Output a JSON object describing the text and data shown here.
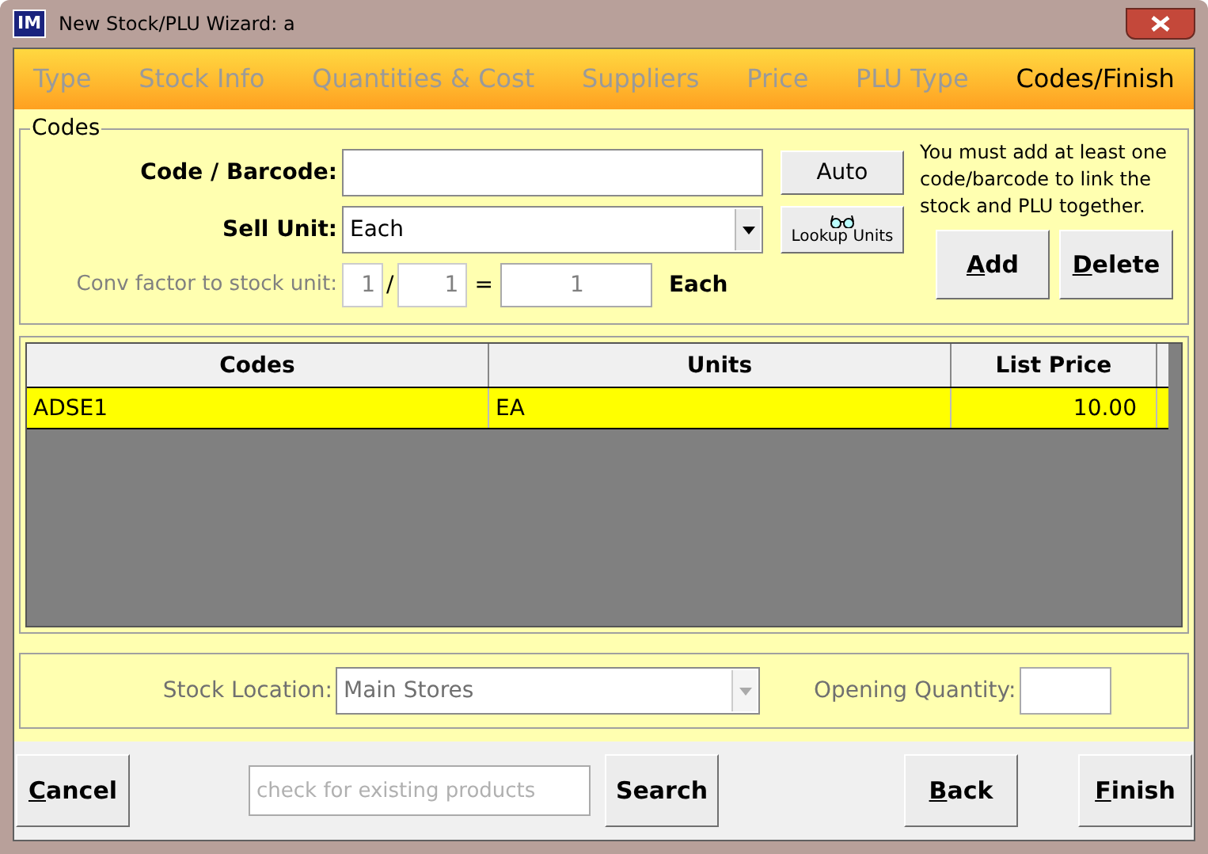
{
  "window": {
    "title": "New Stock/PLU Wizard: a",
    "logo": "IM"
  },
  "tabs": [
    {
      "label": "Type",
      "selected": false
    },
    {
      "label": "Stock Info",
      "selected": false
    },
    {
      "label": "Quantities & Cost",
      "selected": false
    },
    {
      "label": "Suppliers",
      "selected": false
    },
    {
      "label": "Price",
      "selected": false
    },
    {
      "label": "PLU Type",
      "selected": false
    },
    {
      "label": "Codes/Finish",
      "selected": true
    }
  ],
  "codes": {
    "title": "Codes",
    "code_label": "Code / Barcode:",
    "auto_button": "Auto",
    "sell_unit_label": "Sell Unit:",
    "sell_unit_value": "Each",
    "lookup_button": "Lookup Units",
    "conv_label": "Conv factor to stock unit:",
    "conv_num": "1",
    "conv_slash": "/",
    "conv_den": "1",
    "conv_equals": "=",
    "conv_result": "1",
    "conv_unit": "Each",
    "hint": "You must add at least one code/barcode to link the stock and PLU together.",
    "add_button": {
      "label": "Add",
      "underline_first": true
    },
    "delete_button": {
      "label": "Delete",
      "underline_first": true
    }
  },
  "table": {
    "columns": [
      "Codes",
      "Units",
      "List Price"
    ],
    "rows": [
      {
        "cells": [
          "ADSE1",
          "EA",
          "10.00"
        ],
        "selected": true
      }
    ]
  },
  "location": {
    "label": "Stock Location:",
    "value": "Main Stores",
    "disabled": true,
    "opening_label": "Opening Quantity:"
  },
  "footer": {
    "cancel": {
      "label": "Cancel",
      "underline_first": true
    },
    "search_placeholder": "check for existing products",
    "search_button": "Search",
    "back": {
      "label": "Back",
      "underline_first": true
    },
    "finish": {
      "label": "Finish",
      "underline_first": true
    }
  }
}
